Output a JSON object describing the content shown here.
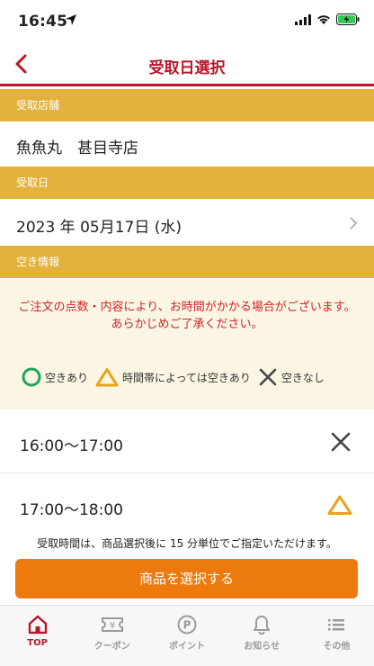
{
  "status_bar": {
    "time": "16:45"
  },
  "header": {
    "title": "受取日選択"
  },
  "store_section": {
    "label": "受取店舗",
    "value": "魚魚丸　甚目寺店"
  },
  "date_section": {
    "label": "受取日",
    "value": "2023 年 05月17日 (水)"
  },
  "availability_section": {
    "label": "空き情報",
    "notice_line1": "ご注文の点数・内容により、お時間がかかる場合がございます。",
    "notice_line2": "あらかじめご了承ください。",
    "legend": [
      {
        "icon": "circle-icon",
        "label": "空きあり"
      },
      {
        "icon": "triangle-icon",
        "label": "時間帯によっては空きあり"
      },
      {
        "icon": "cross-icon",
        "label": "空きなし"
      }
    ]
  },
  "slots": [
    {
      "time": "16:00～17:00",
      "status": "cross-icon"
    },
    {
      "time": "17:00～18:00",
      "status": "triangle-icon"
    }
  ],
  "footnote": "受取時間は、商品選択後に 15 分単位でご指定いただけます。",
  "primary_button": "商品を選択する",
  "tabs": [
    {
      "icon": "home-icon",
      "label": "TOP",
      "active": true
    },
    {
      "icon": "coupon-icon",
      "label": "クーポン"
    },
    {
      "icon": "point-icon",
      "label": "ポイント"
    },
    {
      "icon": "bell-icon",
      "label": "お知らせ"
    },
    {
      "icon": "menu-icon",
      "label": "その他"
    }
  ],
  "colors": {
    "accent": "#b8172b",
    "section": "#e2b23c",
    "button": "#ec7a0e",
    "available": "#21a45b",
    "partial": "#e8a21c",
    "none": "#444444"
  }
}
